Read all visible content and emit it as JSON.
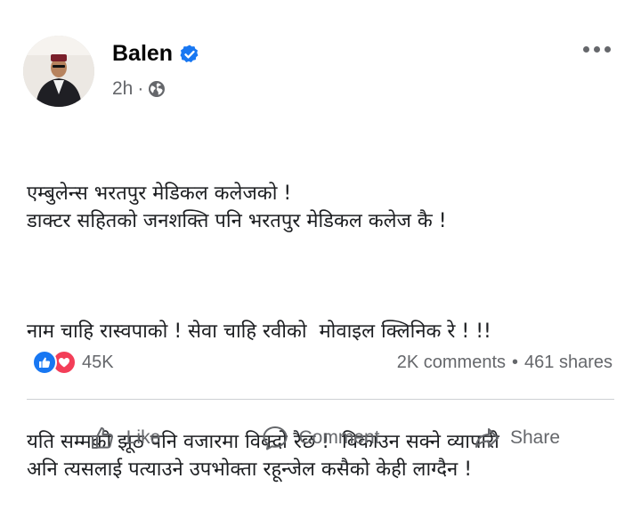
{
  "post": {
    "author": "Balen",
    "time": "2h",
    "meta_separator": "·",
    "icons": {
      "verified": "verified-badge-icon",
      "audience": "globe-icon",
      "menu": "more-options-icon"
    },
    "paragraphs": [
      {
        "lines": [
          "एम्बुलेन्स भरतपुर मेडिकल कलेजको !",
          "डाक्टर सहितको जनशक्ति पनि भरतपुर मेडिकल कलेज कै !"
        ]
      },
      {
        "lines": [
          "नाम चाहि रास्वपाको ! सेवा चाहि रवीको  मोवाइल क्लिनिक रे ! !!"
        ]
      },
      {
        "lines": [
          "यति सम्मको झूठ पनि वजारमा विक्दो रैछ !  विकाउन सक्ने व्यापारी",
          "अनि त्यसलाई पत्याउने उपभोक्ता रहून्जेल कसैको केही लाग्दैन !"
        ]
      }
    ]
  },
  "stats": {
    "reactions": "45K",
    "comments": "2K comments",
    "separator": "•",
    "shares": "461 shares",
    "reaction_icons": [
      "like-reaction-icon",
      "love-reaction-icon"
    ]
  },
  "actions": [
    {
      "label": "Like",
      "icon": "thumbs-up-icon"
    },
    {
      "label": "Comment",
      "icon": "comment-icon"
    },
    {
      "label": "Share",
      "icon": "share-arrow-icon"
    }
  ],
  "colors": {
    "accent": "#1877f2",
    "love": "#f33e58",
    "secondary_text": "#65676b",
    "divider": "#ced0d4"
  }
}
